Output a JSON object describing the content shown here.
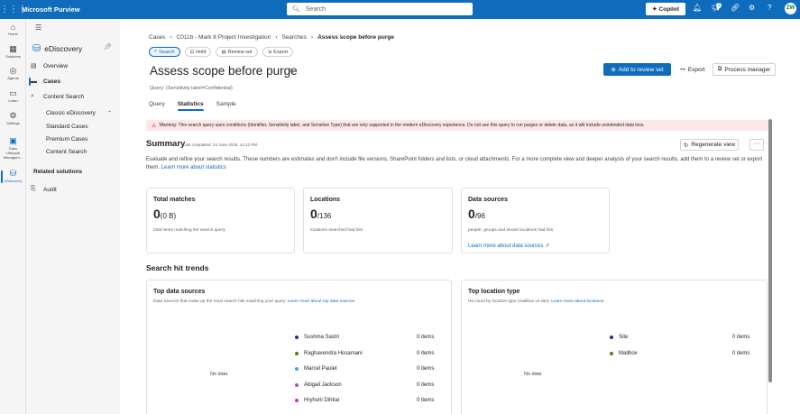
{
  "topbar": {
    "app_name": "Microsoft Purview",
    "search_placeholder": "Search",
    "copilot_label": "Copilot",
    "notification_count": "1",
    "avatar_initials": "ZW"
  },
  "rail": [
    {
      "label": "Home",
      "icon": "home-icon"
    },
    {
      "label": "Solutions",
      "icon": "solutions-icon"
    },
    {
      "label": "Agents",
      "icon": "agents-icon"
    },
    {
      "label": "Learn",
      "icon": "learn-icon"
    },
    {
      "label": "Settings",
      "icon": "settings-icon"
    },
    {
      "label": "Data Lifecycle Managem...",
      "icon": "data-lifecycle-icon"
    },
    {
      "label": "eDiscovery",
      "icon": "ediscovery-icon"
    }
  ],
  "sidenav": {
    "title": "eDiscovery",
    "overview": "Overview",
    "cases": "Cases",
    "content_search": "Content Search",
    "classic": "Classic eDiscovery",
    "standard_cases": "Standard Cases",
    "premium_cases": "Premium Cases",
    "classic_content_search": "Content Search",
    "related": "Related solutions",
    "audit": "Audit"
  },
  "breadcrumb": {
    "items": [
      "Cases",
      "C011b - Mark 8 Project Investigation",
      "Searches"
    ],
    "current": "Assess scope before purge"
  },
  "chips": [
    "Search",
    "Hold",
    "Review set",
    "Export"
  ],
  "page": {
    "title": "Assess scope before purge",
    "query": "Query: (Sensitivity label=Confidential)",
    "add_to_review": "Add to review set",
    "export": "Export",
    "process_manager": "Process manager"
  },
  "tabs": [
    "Query",
    "Statistics",
    "Sample"
  ],
  "warning": "Warning: This search query uses conditions (Identifier, Sensitivity label, and Sensitive Type) that are only supported in the modern eDiscovery experience. Do not use this query to run purges or delete data, as it will include unintended data loss.",
  "summary": {
    "title": "Summary",
    "last_completed": "Last completed: 24 June 2025, 14:12 PM",
    "regenerate": "Regenerate view",
    "description": "Evaluate and refine your search results. These numbers are estimates and don't include file versions, SharePoint folders and lists, or cloud attachments. For a more complete view and deeper analysis of your search results, add them to a review set or export them.",
    "learn_more": "Learn more about statistics"
  },
  "cards": [
    {
      "title": "Total matches",
      "value": "0",
      "suffix": "(0 B)",
      "desc": "total items matching the search query",
      "link": ""
    },
    {
      "title": "Locations",
      "value": "0",
      "suffix": "/136",
      "desc": "locations searched had hits",
      "link": ""
    },
    {
      "title": "Data sources",
      "value": "0",
      "suffix": "/96",
      "desc": "people, groups and tenant locations had hits",
      "link": "Learn more about data sources"
    }
  ],
  "trends": {
    "title": "Search hit trends",
    "top_sources": {
      "title": "Top data sources",
      "desc": "Data sources that make up the most search hits matching your query.",
      "link": "Learn more about top data sources",
      "nodata": "No data",
      "items": [
        {
          "name": "Sushma Sastri",
          "value": "0 items",
          "color": "#2b2b80"
        },
        {
          "name": "Raghavendra Hosamani",
          "value": "0 items",
          "color": "#498205"
        },
        {
          "name": "Marcel Paulet",
          "value": "0 items",
          "color": "#4f9de8"
        },
        {
          "name": "Abigail Jackson",
          "value": "0 items",
          "color": "#8764b8"
        },
        {
          "name": "Hryhorii Dihtiar",
          "value": "0 items",
          "color": "#c239b3"
        }
      ]
    },
    "top_location": {
      "title": "Top location type",
      "desc": "Hit count by location type (mailbox vs site).",
      "link": "Learn more about locations",
      "nodata": "No data",
      "items": [
        {
          "name": "Site",
          "value": "0 items",
          "color": "#2b2b80"
        },
        {
          "name": "Mailbox",
          "value": "0 items",
          "color": "#498205"
        }
      ]
    }
  }
}
